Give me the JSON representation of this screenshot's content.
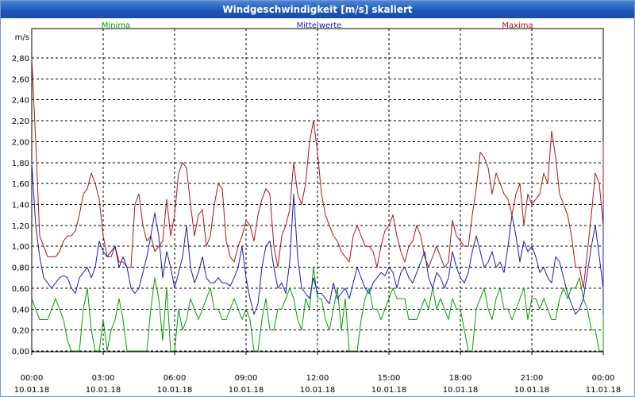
{
  "window": {
    "title": "Windgeschwindigkeit [m/s] skaliert"
  },
  "chart_data": {
    "type": "line",
    "title": "Windgeschwindigkeit [m/s] skaliert",
    "ylabel": "m/s",
    "ylim": [
      0,
      2.9
    ],
    "yticks": [
      "0,00",
      "0,20",
      "0,40",
      "0,60",
      "0,80",
      "1,00",
      "1,20",
      "1,40",
      "1,60",
      "1,80",
      "2,00",
      "2,20",
      "2,40",
      "2,60",
      "2,80"
    ],
    "xlim_hours": [
      0,
      24
    ],
    "xticks": [
      {
        "time": "00:00",
        "date": "10.01.18"
      },
      {
        "time": "03:00",
        "date": "10.01.18"
      },
      {
        "time": "06:00",
        "date": "10.01.18"
      },
      {
        "time": "09:00",
        "date": "10.01.18"
      },
      {
        "time": "12:00",
        "date": "10.01.18"
      },
      {
        "time": "15:00",
        "date": "10.01.18"
      },
      {
        "time": "18:00",
        "date": "10.01.18"
      },
      {
        "time": "21:00",
        "date": "10.01.18"
      },
      {
        "time": "00:00",
        "date": "11.01.18"
      }
    ],
    "grid": true,
    "legend_placement": "top",
    "x_step_minutes": 10,
    "series": [
      {
        "name": "Minima",
        "color": "#00a000",
        "values": [
          0.5,
          0.4,
          0.3,
          0.3,
          0.3,
          0.4,
          0.5,
          0.4,
          0.3,
          0.1,
          0.0,
          0.0,
          0.0,
          0.4,
          0.6,
          0.2,
          0.0,
          0.0,
          0.3,
          0.0,
          0.2,
          0.3,
          0.5,
          0.3,
          0.0,
          0.0,
          0.0,
          0.0,
          0.0,
          0.0,
          0.4,
          0.7,
          0.5,
          0.1,
          0.6,
          0.0,
          0.0,
          0.4,
          0.2,
          0.3,
          0.5,
          0.4,
          0.3,
          0.4,
          0.5,
          0.6,
          0.4,
          0.4,
          0.3,
          0.3,
          0.4,
          0.5,
          0.4,
          0.3,
          0.4,
          0.3,
          0.0,
          0.0,
          0.3,
          0.5,
          0.2,
          0.2,
          0.4,
          0.4,
          0.5,
          0.6,
          0.5,
          0.3,
          0.2,
          0.5,
          0.4,
          0.8,
          0.5,
          0.5,
          0.3,
          0.2,
          0.4,
          0.6,
          0.2,
          0.5,
          0.0,
          0.0,
          0.0,
          0.3,
          0.5,
          0.6,
          0.4,
          0.4,
          0.3,
          0.4,
          0.5,
          0.6,
          0.5,
          0.5,
          0.5,
          0.3,
          0.3,
          0.3,
          0.4,
          0.5,
          0.4,
          0.6,
          0.4,
          0.5,
          0.4,
          0.3,
          0.5,
          0.4,
          0.4,
          0.2,
          0.0,
          0.0,
          0.4,
          0.5,
          0.6,
          0.4,
          0.3,
          0.5,
          0.6,
          0.4,
          0.4,
          0.3,
          0.4,
          0.5,
          0.6,
          0.3,
          0.5,
          0.5,
          0.4,
          0.5,
          0.4,
          0.3,
          0.3,
          0.5,
          0.6,
          0.5,
          0.6,
          0.6,
          0.7,
          0.5,
          0.4,
          0.2,
          0.2,
          0.0,
          0.0,
          0.2,
          0.4,
          0.5,
          0.3,
          0.3,
          0.5,
          0.6,
          0.4,
          0.5,
          0.4,
          0.4,
          0.2,
          0.0,
          0.0,
          0.4,
          0.7,
          0.5,
          0.6,
          0.6,
          0.5,
          0.7,
          0.3,
          0.3,
          0.5,
          0.4,
          0.5,
          0.2,
          0.2,
          0.5,
          0.4,
          0.6,
          0.4,
          0.3,
          0.6,
          0.6,
          0.2,
          0.2,
          0.6,
          0.4,
          0.5,
          0.3,
          0.4,
          0.6,
          0.6,
          0.5,
          0.6,
          0.5,
          0.4,
          0.4,
          0.3,
          0.4,
          0.3,
          0.6,
          0.6,
          0.7,
          0.7,
          0.6,
          0.7,
          0.7,
          0.5,
          0.6,
          0.6,
          0.4,
          0.3,
          0.5,
          0.4,
          0.6,
          0.7,
          0.8,
          0.8,
          0.8,
          0.8,
          0.7,
          0.6,
          0.8,
          0.8,
          0.5,
          0.3,
          0.5,
          0.5,
          0.5,
          0.6,
          0.4,
          0.3,
          0.5,
          0.3,
          0.0,
          0.0
        ]
      },
      {
        "name": "Mittelwerte",
        "color": "#1c1cb4",
        "values": [
          1.8,
          1.2,
          0.9,
          0.7,
          0.65,
          0.6,
          0.65,
          0.7,
          0.72,
          0.7,
          0.6,
          0.55,
          0.7,
          0.75,
          0.8,
          0.7,
          0.8,
          1.05,
          0.95,
          0.9,
          0.95,
          1.0,
          0.8,
          0.9,
          0.8,
          0.6,
          0.55,
          0.6,
          0.75,
          0.9,
          1.1,
          1.32,
          1.1,
          0.7,
          0.95,
          0.8,
          0.6,
          0.75,
          0.9,
          1.2,
          0.8,
          0.65,
          0.75,
          0.9,
          0.7,
          0.65,
          0.65,
          0.7,
          0.65,
          0.65,
          0.62,
          0.7,
          0.8,
          1.0,
          0.7,
          0.5,
          0.35,
          0.45,
          0.8,
          1.0,
          1.05,
          0.8,
          0.6,
          0.65,
          0.55,
          0.85,
          1.5,
          0.9,
          0.6,
          0.55,
          0.5,
          0.7,
          0.55,
          0.55,
          0.5,
          0.45,
          0.65,
          0.5,
          0.55,
          0.6,
          0.5,
          0.65,
          0.8,
          0.7,
          0.6,
          0.55,
          0.65,
          0.7,
          0.75,
          0.72,
          0.8,
          0.75,
          0.6,
          0.75,
          0.8,
          0.7,
          0.65,
          0.75,
          0.85,
          0.95,
          0.7,
          0.6,
          0.75,
          0.7,
          0.6,
          0.7,
          0.95,
          0.8,
          0.7,
          0.65,
          0.75,
          0.95,
          1.1,
          0.95,
          0.8,
          0.85,
          0.95,
          0.8,
          0.85,
          0.75,
          1.0,
          1.3,
          1.1,
          0.85,
          1.05,
          0.95,
          1.0,
          0.9,
          0.75,
          0.8,
          0.7,
          0.65,
          0.9,
          0.85,
          0.7,
          0.55,
          0.45,
          0.35,
          0.4,
          0.5,
          0.75,
          1.0,
          1.2,
          0.9,
          0.6,
          0.7,
          0.8,
          0.8,
          0.75,
          0.95,
          0.85,
          1.0,
          0.9,
          0.8,
          0.6,
          0.35,
          0.65,
          0.95,
          1.2,
          1.25,
          1.0,
          0.85,
          0.8,
          0.6,
          0.7,
          0.65,
          0.85,
          0.7,
          0.8,
          0.8,
          0.75,
          0.6,
          0.7,
          0.65,
          0.55,
          0.62,
          0.7,
          0.6,
          0.65,
          0.75,
          0.6,
          0.7,
          0.8,
          0.8,
          0.7,
          0.75,
          0.8,
          0.7,
          0.75,
          0.85,
          0.9,
          0.95,
          0.75,
          0.7,
          0.8,
          0.9,
          1.05,
          1.0,
          0.85,
          0.8,
          0.9,
          1.1,
          1.45,
          1.2,
          1.0,
          0.85,
          1.0,
          1.1,
          1.0,
          1.05,
          0.9,
          1.1,
          1.15,
          1.0,
          0.9,
          0.8,
          0.7,
          0.75,
          0.9,
          1.15,
          1.0,
          0.8,
          0.85,
          0.95,
          1.05,
          1.2,
          0.9,
          0.7,
          0.6,
          0.55,
          0.6,
          0.5,
          0.5
        ]
      },
      {
        "name": "Maxima",
        "color": "#b01414",
        "values": [
          2.8,
          2.0,
          1.1,
          1.0,
          0.9,
          0.9,
          0.9,
          0.95,
          1.05,
          1.1,
          1.1,
          1.15,
          1.3,
          1.5,
          1.55,
          1.7,
          1.6,
          1.45,
          1.1,
          0.9,
          0.9,
          1.0,
          0.85,
          0.85,
          0.8,
          0.8,
          1.4,
          1.5,
          1.2,
          1.05,
          1.1,
          0.95,
          1.0,
          1.05,
          1.45,
          1.1,
          1.3,
          1.7,
          1.8,
          1.75,
          1.4,
          1.1,
          1.3,
          1.35,
          1.0,
          1.1,
          1.4,
          1.6,
          1.55,
          1.05,
          0.9,
          0.85,
          1.0,
          1.1,
          1.25,
          1.2,
          1.05,
          1.3,
          1.45,
          1.55,
          1.5,
          1.0,
          0.8,
          1.1,
          1.2,
          1.35,
          1.8,
          1.5,
          1.4,
          1.6,
          2.0,
          2.2,
          1.9,
          1.5,
          1.3,
          1.2,
          1.1,
          1.05,
          0.95,
          0.9,
          0.85,
          1.1,
          1.2,
          1.1,
          1.0,
          1.0,
          0.95,
          0.8,
          1.0,
          1.15,
          1.2,
          1.3,
          1.1,
          0.95,
          0.85,
          1.0,
          1.05,
          1.2,
          1.1,
          0.9,
          0.8,
          0.9,
          1.0,
          0.9,
          0.8,
          0.85,
          1.25,
          1.1,
          1.05,
          1.0,
          1.0,
          1.3,
          1.55,
          1.9,
          1.85,
          1.75,
          1.5,
          1.7,
          1.6,
          1.5,
          1.45,
          1.3,
          1.5,
          1.6,
          1.2,
          1.5,
          1.4,
          1.45,
          1.5,
          1.7,
          1.6,
          2.1,
          1.85,
          1.5,
          1.4,
          1.3,
          1.1,
          0.8,
          0.8,
          0.6,
          0.95,
          1.3,
          1.7,
          1.6,
          1.2,
          1.3,
          1.8,
          1.5,
          1.1,
          1.2,
          1.35,
          1.4,
          1.6,
          1.1,
          0.8,
          0.85,
          1.3,
          1.5,
          1.6,
          1.4,
          1.2,
          1.1,
          1.3,
          1.0,
          0.9,
          1.1,
          1.25,
          1.3,
          1.2,
          0.9,
          1.05,
          1.1,
          1.2,
          1.1,
          1.0,
          0.8,
          0.85,
          0.8,
          0.8,
          0.9,
          0.95,
          1.0,
          1.05,
          0.95,
          0.8,
          0.85,
          0.9,
          0.95,
          1.1,
          1.15,
          1.1,
          1.3,
          1.25,
          1.35,
          1.4,
          1.3,
          1.55,
          1.35,
          1.5,
          1.8,
          2.0,
          1.9,
          1.6,
          1.3,
          1.0,
          1.5,
          1.6,
          1.6,
          1.5,
          1.4,
          1.2,
          1.3,
          1.5,
          1.3,
          1.2,
          1.5,
          1.5,
          1.2,
          1.0,
          0.8,
          0.8
        ]
      }
    ]
  }
}
